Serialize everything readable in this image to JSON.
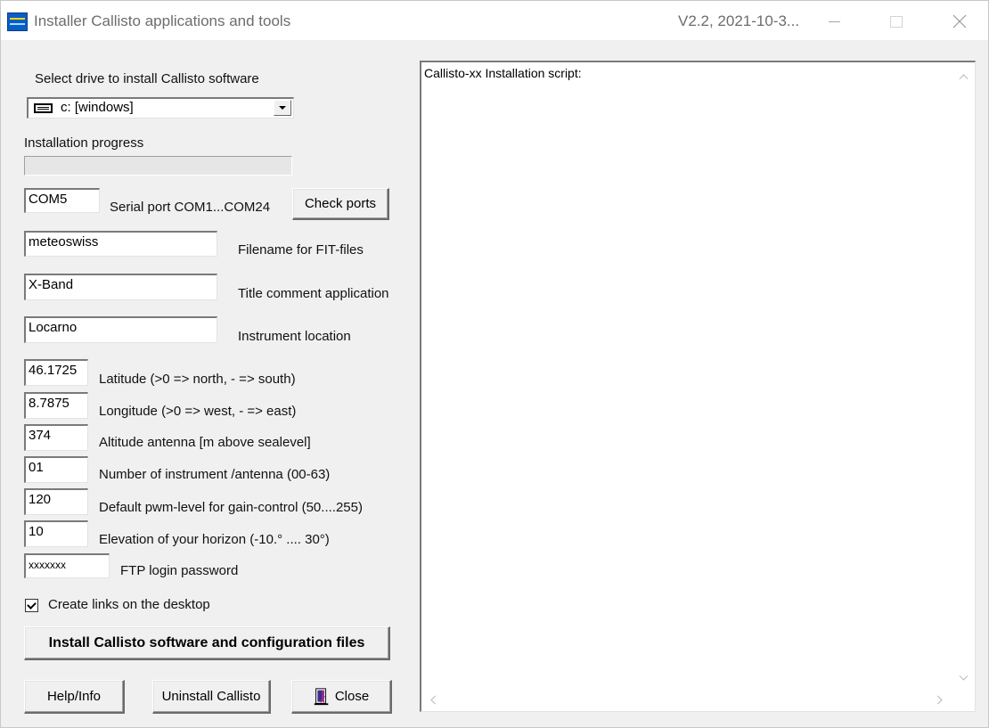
{
  "window": {
    "title": "Installer Callisto applications and tools",
    "version": "V2.2, 2021-10-3..."
  },
  "drive": {
    "label": "Select drive to install Callisto software",
    "selected": "c: [windows]"
  },
  "progress": {
    "label": "Installation progress",
    "value": 0
  },
  "serial": {
    "value": "COM5",
    "label": "Serial port COM1...COM24",
    "check_button": "Check ports"
  },
  "fields": {
    "filename": {
      "value": "meteoswiss",
      "label": "Filename for FIT-files"
    },
    "title_comment": {
      "value": "X-Band",
      "label": "Title comment application"
    },
    "location": {
      "value": "Locarno",
      "label": "Instrument location"
    },
    "latitude": {
      "value": "46.1725",
      "label": "Latitude (>0 => north, - => south)"
    },
    "longitude": {
      "value": "8.7875",
      "label": "Longitude (>0 => west, - => east)"
    },
    "altitude": {
      "value": "374",
      "label": "Altitude antenna [m above sealevel]"
    },
    "instrument_number": {
      "value": "01",
      "label": "Number of instrument /antenna (00-63)"
    },
    "pwm_level": {
      "value": "120",
      "label": "Default pwm-level for gain-control  (50....255)"
    },
    "horizon": {
      "value": "10",
      "label": "Elevation of your horizon (-10.° .... 30°)"
    },
    "ftp_password": {
      "value": "xxxxxxx",
      "label": "FTP login password"
    }
  },
  "desktop_links": {
    "label": "Create links on the desktop",
    "checked": true
  },
  "buttons": {
    "install": "Install Callisto software and configuration files",
    "help": "Help/Info",
    "uninstall": "Uninstall Callisto",
    "close": "Close"
  },
  "script_memo": {
    "text": "Callisto-xx Installation script:"
  },
  "colors": {
    "window_bg": "#f0f0f0",
    "titlebar_bg": "#ffffff",
    "title_text": "#6d6d6d",
    "app_icon": "#0a5cc8"
  },
  "icons": {
    "app": "callisto-app-icon",
    "drive": "drive-icon",
    "close": "door-exit-icon"
  }
}
